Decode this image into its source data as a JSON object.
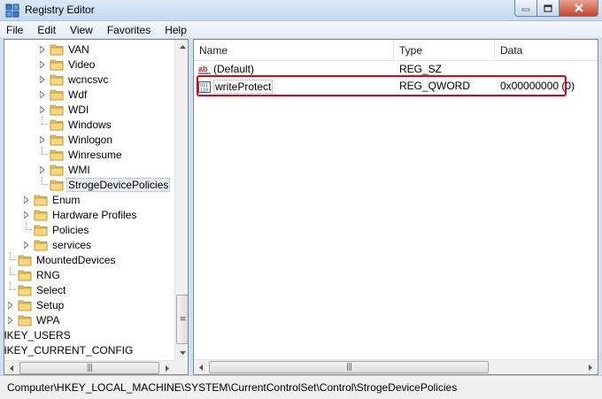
{
  "window": {
    "title": "Registry Editor"
  },
  "menu": [
    "File",
    "Edit",
    "View",
    "Favorites",
    "Help"
  ],
  "tree": {
    "items": [
      {
        "label": "VAN",
        "expander": "plus"
      },
      {
        "label": "Video",
        "expander": "plus"
      },
      {
        "label": "wcncsvc",
        "expander": "plus"
      },
      {
        "label": "Wdf",
        "expander": "plus"
      },
      {
        "label": "WDI",
        "expander": "plus"
      },
      {
        "label": "Windows",
        "expander": "none"
      },
      {
        "label": "Winlogon",
        "expander": "plus"
      },
      {
        "label": "Winresume",
        "expander": "none"
      },
      {
        "label": "WMI",
        "expander": "plus"
      },
      {
        "label": "StrogeDevicePolicies",
        "expander": "none",
        "selected": true
      },
      {
        "label": "Enum",
        "expander": "plus"
      },
      {
        "label": "Hardware Profiles",
        "expander": "plus"
      },
      {
        "label": "Policies",
        "expander": "none"
      },
      {
        "label": "services",
        "expander": "plus"
      },
      {
        "label": "MountedDevices",
        "expander": "none"
      },
      {
        "label": "RNG",
        "expander": "none"
      },
      {
        "label": "Select",
        "expander": "none"
      },
      {
        "label": "Setup",
        "expander": "plus"
      },
      {
        "label": "WPA",
        "expander": "plus"
      },
      {
        "label": "HKEY_USERS",
        "expander": "none"
      },
      {
        "label": "HKEY_CURRENT_CONFIG",
        "expander": "none"
      }
    ]
  },
  "values_pane": {
    "columns": [
      "Name",
      "Type",
      "Data"
    ],
    "rows": [
      {
        "name": "(Default)",
        "type": "REG_SZ",
        "data": "",
        "icon": "string-value-icon"
      },
      {
        "name": "writeProtect",
        "type": "REG_QWORD",
        "data": "0x00000000 (0)",
        "icon": "binary-value-icon"
      }
    ]
  },
  "status_bar": {
    "path": "Computer\\HKEY_LOCAL_MACHINE\\SYSTEM\\CurrentControlSet\\Control\\StrogeDevicePolicies"
  },
  "colors": {
    "highlight": "#e3000f",
    "folder": "#e9c15a",
    "window_frame": "#cfe0f3"
  }
}
